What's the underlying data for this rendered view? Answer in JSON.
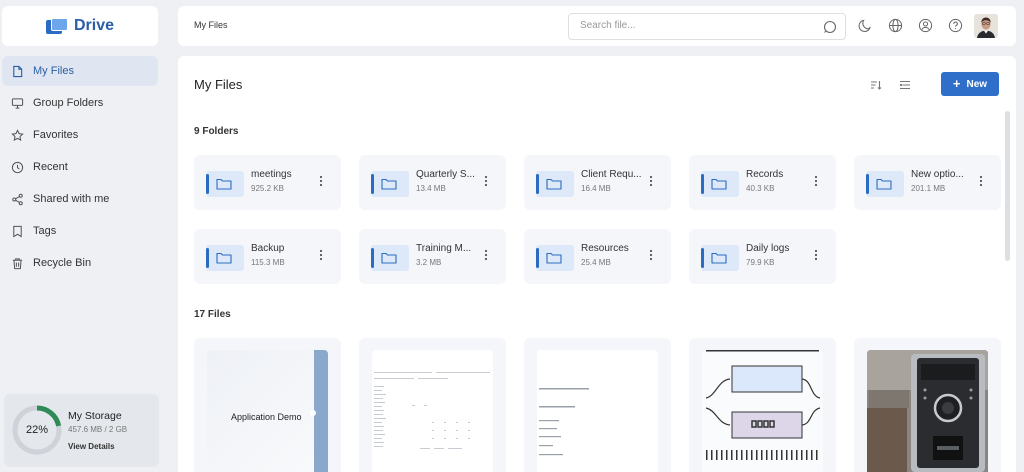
{
  "app": {
    "name": "Drive"
  },
  "sidebar": {
    "items": [
      {
        "label": "My Files",
        "icon": "file-icon",
        "active": true
      },
      {
        "label": "Group Folders",
        "icon": "monitor-icon",
        "active": false
      },
      {
        "label": "Favorites",
        "icon": "star-icon",
        "active": false
      },
      {
        "label": "Recent",
        "icon": "clock-icon",
        "active": false
      },
      {
        "label": "Shared with me",
        "icon": "share-icon",
        "active": false
      },
      {
        "label": "Tags",
        "icon": "tag-icon",
        "active": false
      },
      {
        "label": "Recycle Bin",
        "icon": "trash-icon",
        "active": false
      }
    ]
  },
  "storage": {
    "title": "My Storage",
    "percent": 22,
    "percent_label": "22%",
    "usage": "457.6 MB / 2 GB",
    "link": "View Details"
  },
  "header": {
    "breadcrumb": "My Files",
    "search_placeholder": "Search file...",
    "icons": [
      "moon-icon",
      "globe-icon",
      "user-icon",
      "help-icon"
    ]
  },
  "main": {
    "title": "My Files",
    "new_label": "New",
    "folders_heading": "9 Folders",
    "files_heading": "17 Files",
    "folders": [
      {
        "name": "meetings",
        "size": "925.2 KB"
      },
      {
        "name": "Quarterly S...",
        "size": "13.4 MB"
      },
      {
        "name": "Client Requ...",
        "size": "16.4 MB"
      },
      {
        "name": "Records",
        "size": "40.3 KB"
      },
      {
        "name": "New optio...",
        "size": "201.1 MB"
      },
      {
        "name": "Backup",
        "size": "115.3 MB"
      },
      {
        "name": "Training M...",
        "size": "3.2 MB"
      },
      {
        "name": "Resources",
        "size": "25.4 MB"
      },
      {
        "name": "Daily logs",
        "size": "79.9 KB"
      }
    ],
    "files": [
      {
        "thumb_text": "Application Demo"
      }
    ]
  },
  "colors": {
    "accent": "#2f6fc9",
    "storage_ring": "#2e8b57",
    "folder_blue": "#2a6bc4"
  }
}
